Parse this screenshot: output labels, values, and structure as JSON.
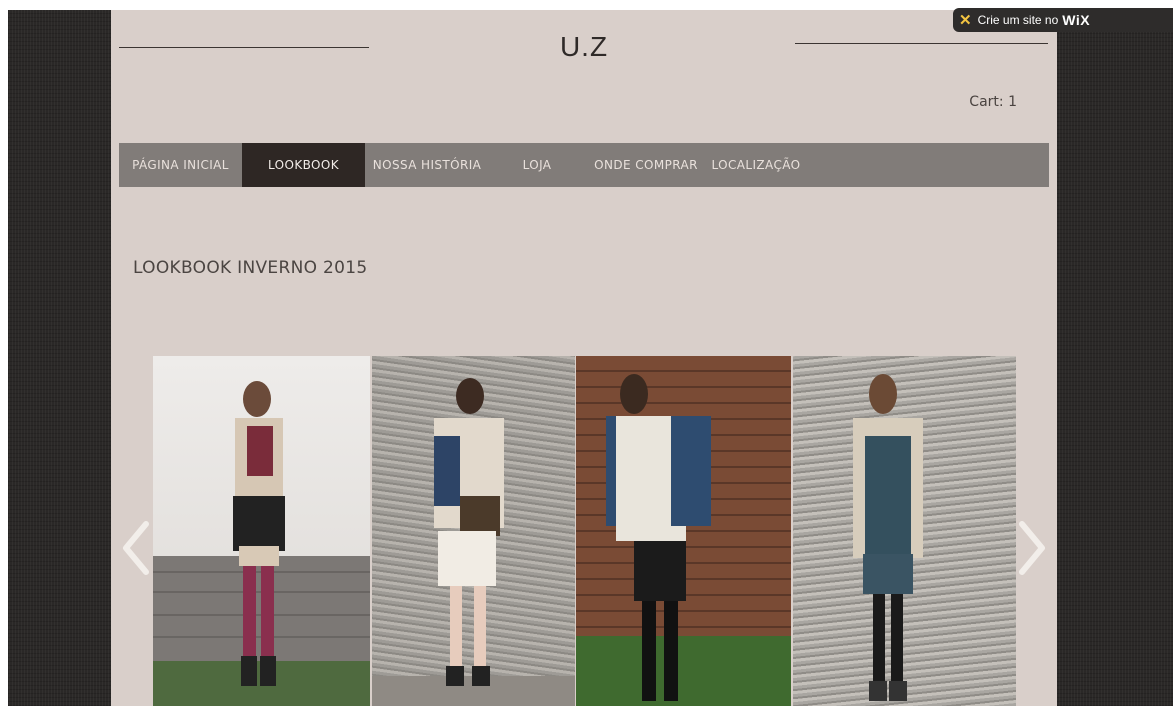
{
  "site": {
    "title": "U.Z"
  },
  "cart": {
    "label": "Cart:",
    "count": "1"
  },
  "nav": {
    "items": [
      {
        "label": "PÁGINA INICIAL",
        "active": false
      },
      {
        "label": "LOOKBOOK",
        "active": true
      },
      {
        "label": "NOSSA HISTÓRIA",
        "active": false
      },
      {
        "label": "LOJA",
        "active": false
      },
      {
        "label": "ONDE COMPRAR",
        "active": false
      },
      {
        "label": "LOCALIZAÇÃO",
        "active": false
      }
    ]
  },
  "main": {
    "heading": "LOOKBOOK INVERNO 2015"
  },
  "wix": {
    "text": "Crie um site no",
    "brand": "WiX"
  },
  "colors": {
    "page_bg": "#d9cfca",
    "nav_bg": "#817c79",
    "nav_active_bg": "#2e2724"
  },
  "gallery": {
    "photos": [
      {
        "icon": "lookbook-photo-1"
      },
      {
        "icon": "lookbook-photo-2"
      },
      {
        "icon": "lookbook-photo-3"
      },
      {
        "icon": "lookbook-photo-4"
      }
    ]
  }
}
